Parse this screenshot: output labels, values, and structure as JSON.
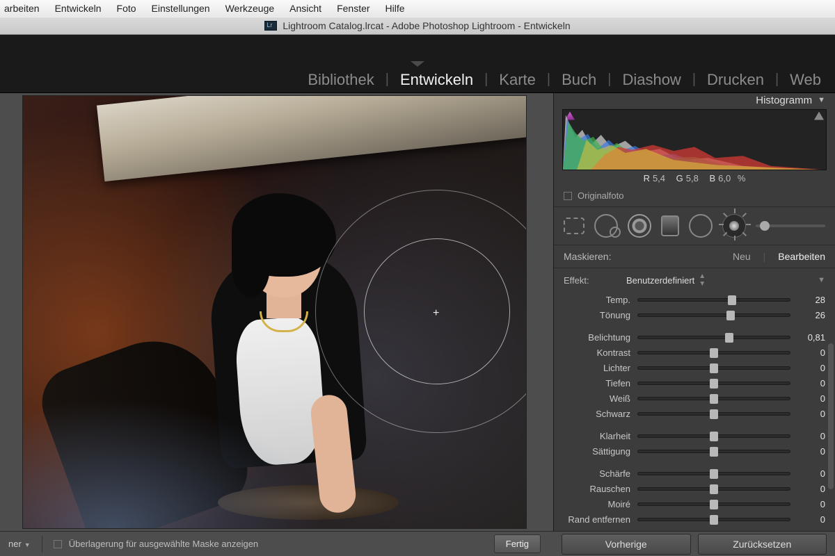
{
  "os_menu": [
    "arbeiten",
    "Entwickeln",
    "Foto",
    "Einstellungen",
    "Werkzeuge",
    "Ansicht",
    "Fenster",
    "Hilfe"
  ],
  "window_title": "Lightroom Catalog.lrcat - Adobe Photoshop Lightroom - Entwickeln",
  "modules": {
    "items": [
      "Bibliothek",
      "Entwickeln",
      "Karte",
      "Buch",
      "Diashow",
      "Drucken",
      "Web"
    ],
    "active": "Entwickeln"
  },
  "panel": {
    "histogram_title": "Histogramm",
    "readout": {
      "r_label": "R",
      "r": "5,4",
      "g_label": "G",
      "g": "5,8",
      "b_label": "B",
      "b": "6,0",
      "pct": "%"
    },
    "original_label": "Originalfoto",
    "mask": {
      "label": "Maskieren:",
      "new": "Neu",
      "edit": "Bearbeiten"
    },
    "effect": {
      "label": "Effekt:",
      "value": "Benutzerdefiniert"
    },
    "sliders": [
      {
        "label": "Temp.",
        "value": "28",
        "pos": 62,
        "grad": "grad-temp"
      },
      {
        "label": "Tönung",
        "value": "26",
        "pos": 61,
        "grad": "grad-tint"
      },
      {
        "gap": true
      },
      {
        "label": "Belichtung",
        "value": "0,81",
        "pos": 60,
        "grad": "grad-exp"
      },
      {
        "label": "Kontrast",
        "value": "0",
        "pos": 50,
        "grad": "grad-contrast"
      },
      {
        "label": "Lichter",
        "value": "0",
        "pos": 50,
        "grad": "grad-gray"
      },
      {
        "label": "Tiefen",
        "value": "0",
        "pos": 50,
        "grad": "grad-gray"
      },
      {
        "label": "Weiß",
        "value": "0",
        "pos": 50,
        "grad": "grad-gray"
      },
      {
        "label": "Schwarz",
        "value": "0",
        "pos": 50,
        "grad": "grad-gray"
      },
      {
        "gap": true
      },
      {
        "label": "Klarheit",
        "value": "0",
        "pos": 50,
        "grad": "grad-gray"
      },
      {
        "label": "Sättigung",
        "value": "0",
        "pos": 50,
        "grad": "grad-sat"
      },
      {
        "gap": true
      },
      {
        "label": "Schärfe",
        "value": "0",
        "pos": 50,
        "grad": "grad-sharp"
      },
      {
        "label": "Rauschen",
        "value": "0",
        "pos": 50,
        "grad": "grad-gray"
      },
      {
        "label": "Moiré",
        "value": "0",
        "pos": 50,
        "grad": "grad-gray"
      },
      {
        "label": "Rand entfernen",
        "value": "0",
        "pos": 50,
        "grad": "grad-gray"
      }
    ]
  },
  "bottom": {
    "dropdown": "ner",
    "overlay_checkbox_label": "Überlagerung für ausgewählte Maske anzeigen",
    "done": "Fertig",
    "prev": "Vorherige",
    "reset": "Zurücksetzen"
  }
}
